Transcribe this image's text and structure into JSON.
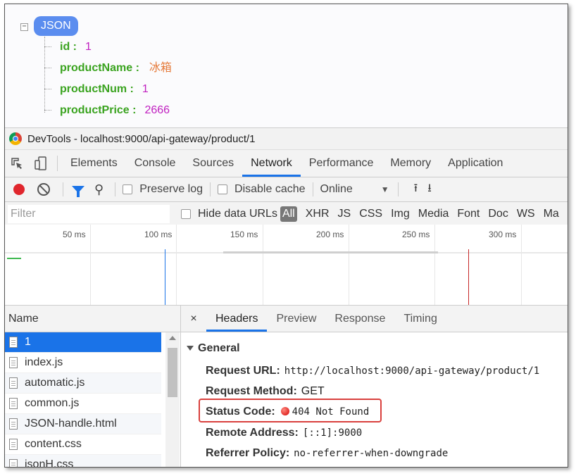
{
  "json_viewer": {
    "root_label": "JSON",
    "collapse_symbol": "−",
    "fields": [
      {
        "key": "id :",
        "value": "1",
        "type": "number"
      },
      {
        "key": "productName :",
        "value": "冰箱",
        "type": "string"
      },
      {
        "key": "productNum :",
        "value": "1",
        "type": "number"
      },
      {
        "key": "productPrice :",
        "value": "2666",
        "type": "number"
      }
    ]
  },
  "devtools": {
    "title": "DevTools - localhost:9000/api-gateway/product/1",
    "tabs": [
      "Elements",
      "Console",
      "Sources",
      "Network",
      "Performance",
      "Memory",
      "Application"
    ],
    "active_tab": "Network",
    "network_toolbar": {
      "preserve_log": "Preserve log",
      "disable_cache": "Disable cache",
      "throttle": "Online"
    },
    "filter": {
      "placeholder": "Filter",
      "hide_data_urls": "Hide data URLs",
      "all": "All",
      "types": [
        "XHR",
        "JS",
        "CSS",
        "Img",
        "Media",
        "Font",
        "Doc",
        "WS",
        "Ma"
      ]
    },
    "timeline": {
      "labels": [
        "50 ms",
        "100 ms",
        "150 ms",
        "200 ms",
        "250 ms",
        "300 ms"
      ]
    },
    "requests": {
      "header": "Name",
      "items": [
        "1",
        "index.js",
        "automatic.js",
        "common.js",
        "JSON-handle.html",
        "content.css",
        "jsonH.css"
      ]
    },
    "details": {
      "close": "×",
      "tabs": [
        "Headers",
        "Preview",
        "Response",
        "Timing"
      ],
      "active_tab": "Headers",
      "section": "General",
      "rows": [
        {
          "key": "Request URL:",
          "value": "http://localhost:9000/api-gateway/product/1"
        },
        {
          "key": "Request Method:",
          "value": "GET"
        },
        {
          "key": "Status Code:",
          "value": "404 Not Found"
        },
        {
          "key": "Remote Address:",
          "value": "[::1]:9000"
        },
        {
          "key": "Referrer Policy:",
          "value": "no-referrer-when-downgrade"
        }
      ]
    }
  },
  "colors": {
    "accent": "#1a73e8",
    "json_key": "#3aa31f",
    "json_number": "#c01fc0",
    "json_string": "#e57a3a",
    "status_error": "#d9403d"
  }
}
